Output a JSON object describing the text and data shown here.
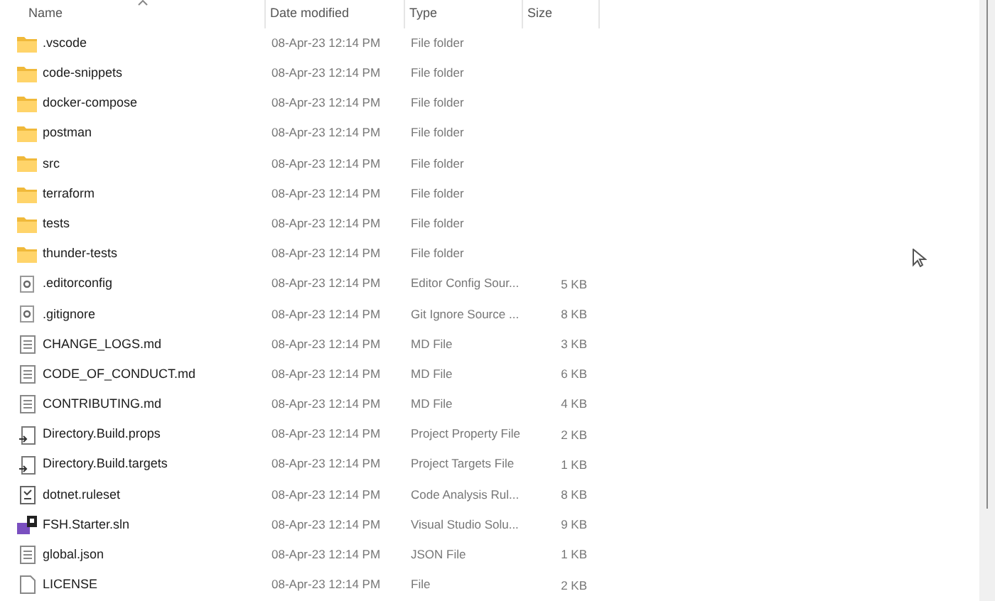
{
  "columns": [
    {
      "label": "Name",
      "sorted": true
    },
    {
      "label": "Date modified",
      "sorted": false
    },
    {
      "label": "Type",
      "sorted": false
    },
    {
      "label": "Size",
      "sorted": false
    }
  ],
  "rows": [
    {
      "kind": "folder",
      "name": ".vscode",
      "date": "08-Apr-23 12:14 PM",
      "type": "File folder"
    },
    {
      "kind": "folder",
      "name": "code-snippets",
      "date": "08-Apr-23 12:14 PM",
      "type": "File folder"
    },
    {
      "kind": "folder",
      "name": "docker-compose",
      "date": "08-Apr-23 12:14 PM",
      "type": "File folder"
    },
    {
      "kind": "folder",
      "name": "postman",
      "date": "08-Apr-23 12:14 PM",
      "type": "File folder"
    },
    {
      "kind": "folder",
      "name": "src",
      "date": "08-Apr-23 12:14 PM",
      "type": "File folder"
    },
    {
      "kind": "folder",
      "name": "terraform",
      "date": "08-Apr-23 12:14 PM",
      "type": "File folder"
    },
    {
      "kind": "folder",
      "name": "tests",
      "date": "08-Apr-23 12:14 PM",
      "type": "File folder"
    },
    {
      "kind": "folder",
      "name": "thunder-tests",
      "date": "08-Apr-23 12:14 PM",
      "type": "File folder"
    },
    {
      "kind": "config",
      "name": ".editorconfig",
      "date": "08-Apr-23 12:14 PM",
      "type": "Editor Config Sour...",
      "size": "5 KB"
    },
    {
      "kind": "config",
      "name": ".gitignore",
      "date": "08-Apr-23 12:14 PM",
      "type": "Git Ignore Source ...",
      "size": "8 KB"
    },
    {
      "kind": "text",
      "name": "CHANGE_LOGS.md",
      "date": "08-Apr-23 12:14 PM",
      "type": "MD File",
      "size": "3 KB"
    },
    {
      "kind": "text",
      "name": "CODE_OF_CONDUCT.md",
      "date": "08-Apr-23 12:14 PM",
      "type": "MD File",
      "size": "6 KB"
    },
    {
      "kind": "text",
      "name": "CONTRIBUTING.md",
      "date": "08-Apr-23 12:14 PM",
      "type": "MD File",
      "size": "4 KB"
    },
    {
      "kind": "project",
      "name": "Directory.Build.props",
      "date": "08-Apr-23 12:14 PM",
      "type": "Project Property File",
      "size": "2 KB"
    },
    {
      "kind": "project",
      "name": "Directory.Build.targets",
      "date": "08-Apr-23 12:14 PM",
      "type": "Project Targets File",
      "size": "1 KB"
    },
    {
      "kind": "ruleset",
      "name": "dotnet.ruleset",
      "date": "08-Apr-23 12:14 PM",
      "type": "Code Analysis Rul...",
      "size": "8 KB"
    },
    {
      "kind": "solution",
      "name": "FSH.Starter.sln",
      "date": "08-Apr-23 12:14 PM",
      "type": "Visual Studio Solu...",
      "size": "9 KB"
    },
    {
      "kind": "text",
      "name": "global.json",
      "date": "08-Apr-23 12:14 PM",
      "type": "JSON File",
      "size": "1 KB"
    },
    {
      "kind": "file",
      "name": "LICENSE",
      "date": "08-Apr-23 12:14 PM",
      "type": "File",
      "size": "2 KB"
    }
  ]
}
